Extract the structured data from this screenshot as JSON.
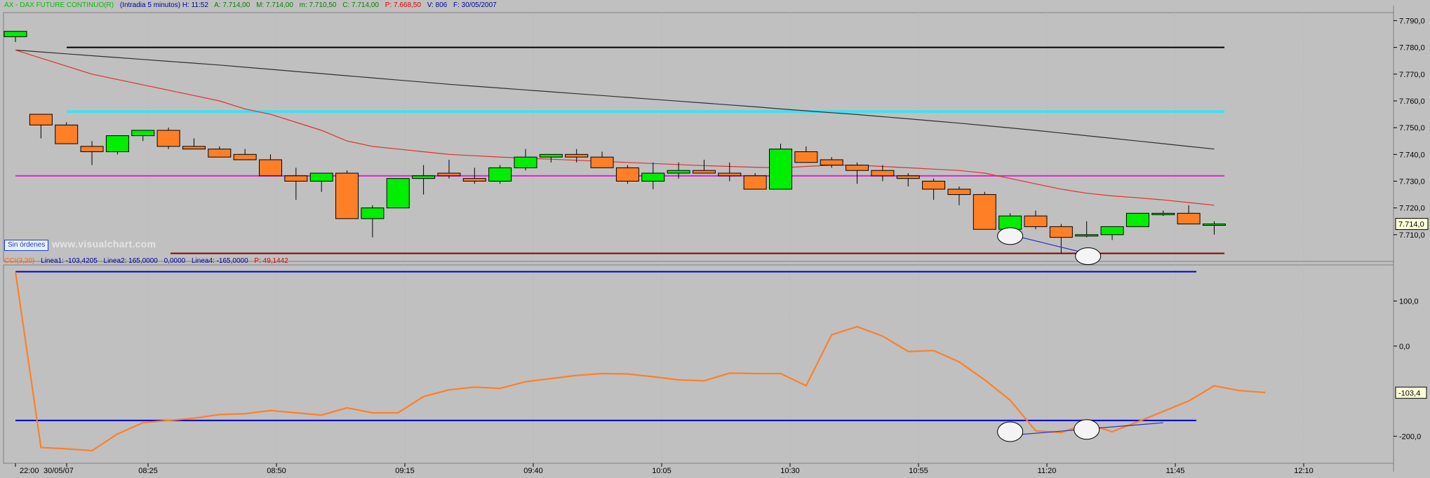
{
  "colors": {
    "up": "#00ee00",
    "down": "#ff7f27",
    "price_ma1": "#e03030",
    "price_ma2": "#303030",
    "line_cyan": "#40e0f0",
    "line_magenta": "#e020e0",
    "line_black": "#000000",
    "line_darkred": "#8b0000",
    "cci": "#ff7f27",
    "bound": "#0000cc"
  },
  "top_header": {
    "name": "AX - DAX FUTURE CONTINUO(R)",
    "period": "(Intradia 5 minutos) H: 11:52",
    "a": "A: 7.714,00",
    "m": "M: 7.714,00",
    "mn": "m: 7.710,50",
    "c": "C: 7.714,00",
    "p": "P: 7.668,50",
    "v": "V: 806",
    "f": "F: 30/05/2007"
  },
  "bottom_header": {
    "name": "CCI(3,20)",
    "l1": "Linea1: -103,4205",
    "l2": "Linea2: 165,0000",
    "l3": "0,0000",
    "l4": "Linea4: -165,0000",
    "p": "P: 49,1442"
  },
  "orders_badge": "Sin órdenes",
  "watermark": "www.visualchart.com",
  "last_price_label": "7.714,0",
  "last_cci_label": "-103,4",
  "chart_data": [
    {
      "type": "candlestick",
      "x_labels": [
        "22:00",
        "30/05/07",
        "08:25",
        "08:50",
        "09:15",
        "09:40",
        "10:05",
        "10:30",
        "10:55",
        "11:20",
        "11:45",
        "12:10"
      ],
      "y_ticks": [
        "7.790,0",
        "7.780,0",
        "7.770,0",
        "7.760,0",
        "7.750,0",
        "7.740,0",
        "7.730,0",
        "7.720,0",
        "7.710,0"
      ],
      "ylim": [
        7700,
        7793
      ],
      "candles": [
        {
          "o": 7784,
          "h": 7786,
          "l": 7782,
          "c": 7786
        },
        {
          "o": 7755,
          "h": 7755,
          "l": 7746,
          "c": 7751
        },
        {
          "o": 7751,
          "h": 7752,
          "l": 7744,
          "c": 7744
        },
        {
          "o": 7743,
          "h": 7745,
          "l": 7736,
          "c": 7741
        },
        {
          "o": 7741,
          "h": 7747,
          "l": 7740,
          "c": 7747
        },
        {
          "o": 7747,
          "h": 7749,
          "l": 7745,
          "c": 7749
        },
        {
          "o": 7749,
          "h": 7750,
          "l": 7742,
          "c": 7743
        },
        {
          "o": 7743,
          "h": 7746,
          "l": 7742,
          "c": 7742
        },
        {
          "o": 7742,
          "h": 7743,
          "l": 7739,
          "c": 7739
        },
        {
          "o": 7740,
          "h": 7742,
          "l": 7738,
          "c": 7738
        },
        {
          "o": 7738,
          "h": 7740,
          "l": 7732,
          "c": 7732
        },
        {
          "o": 7732,
          "h": 7735,
          "l": 7723,
          "c": 7730
        },
        {
          "o": 7730,
          "h": 7733,
          "l": 7726,
          "c": 7733
        },
        {
          "o": 7733,
          "h": 7734,
          "l": 7716,
          "c": 7716
        },
        {
          "o": 7716,
          "h": 7721,
          "l": 7709,
          "c": 7720
        },
        {
          "o": 7720,
          "h": 7731,
          "l": 7720,
          "c": 7731
        },
        {
          "o": 7731,
          "h": 7736,
          "l": 7725,
          "c": 7732
        },
        {
          "o": 7733,
          "h": 7738,
          "l": 7731,
          "c": 7732
        },
        {
          "o": 7731,
          "h": 7735,
          "l": 7729,
          "c": 7730
        },
        {
          "o": 7730,
          "h": 7736,
          "l": 7729,
          "c": 7735
        },
        {
          "o": 7735,
          "h": 7742,
          "l": 7734,
          "c": 7739
        },
        {
          "o": 7739,
          "h": 7740,
          "l": 7737,
          "c": 7740
        },
        {
          "o": 7740,
          "h": 7742,
          "l": 7737,
          "c": 7739
        },
        {
          "o": 7739,
          "h": 7741,
          "l": 7735,
          "c": 7735
        },
        {
          "o": 7735,
          "h": 7736,
          "l": 7729,
          "c": 7730
        },
        {
          "o": 7730,
          "h": 7737,
          "l": 7727,
          "c": 7733
        },
        {
          "o": 7733,
          "h": 7737,
          "l": 7731,
          "c": 7734
        },
        {
          "o": 7734,
          "h": 7738,
          "l": 7733,
          "c": 7733
        },
        {
          "o": 7733,
          "h": 7737,
          "l": 7730,
          "c": 7732
        },
        {
          "o": 7732,
          "h": 7733,
          "l": 7727,
          "c": 7727
        },
        {
          "o": 7727,
          "h": 7744,
          "l": 7727,
          "c": 7742
        },
        {
          "o": 7741,
          "h": 7743,
          "l": 7737,
          "c": 7737
        },
        {
          "o": 7738,
          "h": 7739,
          "l": 7735,
          "c": 7736
        },
        {
          "o": 7736,
          "h": 7737,
          "l": 7729,
          "c": 7734
        },
        {
          "o": 7734,
          "h": 7736,
          "l": 7730,
          "c": 7732
        },
        {
          "o": 7732,
          "h": 7733,
          "l": 7728,
          "c": 7731
        },
        {
          "o": 7730,
          "h": 7731,
          "l": 7723,
          "c": 7727
        },
        {
          "o": 7727,
          "h": 7728,
          "l": 7721,
          "c": 7725
        },
        {
          "o": 7725,
          "h": 7726,
          "l": 7712,
          "c": 7712
        },
        {
          "o": 7712,
          "h": 7718,
          "l": 7711,
          "c": 7717
        },
        {
          "o": 7717,
          "h": 7719,
          "l": 7712,
          "c": 7713
        },
        {
          "o": 7713,
          "h": 7714,
          "l": 7703,
          "c": 7709
        },
        {
          "o": 7710,
          "h": 7715,
          "l": 7709,
          "c": 7710
        },
        {
          "o": 7710,
          "h": 7711,
          "l": 7708,
          "c": 7713
        },
        {
          "o": 7713,
          "h": 7718,
          "l": 7713,
          "c": 7718
        },
        {
          "o": 7718,
          "h": 7719,
          "l": 7717,
          "c": 7718
        },
        {
          "o": 7718,
          "h": 7721,
          "l": 7714,
          "c": 7714
        },
        {
          "o": 7714,
          "h": 7715,
          "l": 7710,
          "c": 7714
        }
      ],
      "moving_average_red": [
        7779,
        7776,
        7773,
        7770,
        7768,
        7766,
        7764,
        7762,
        7760,
        7757,
        7755,
        7752,
        7749,
        7745,
        7743,
        7742,
        7741,
        7740,
        7739.5,
        7739,
        7738.6,
        7738.2,
        7737.8,
        7737.4,
        7737,
        7736.6,
        7736.2,
        7735.8,
        7735.5,
        7735.2,
        7735,
        7735.5,
        7736,
        7736,
        7735.5,
        7735,
        7734.5,
        7734,
        7733,
        7731,
        7729,
        7727,
        7725.5,
        7724.5,
        7723.8,
        7723,
        7722,
        7721
      ],
      "moving_average_black": [
        7779,
        7778.3,
        7777.6,
        7776.9,
        7776.2,
        7775.5,
        7774.8,
        7774.1,
        7773.4,
        7772.6,
        7771.8,
        7771,
        7770.2,
        7769.4,
        7768.6,
        7767.8,
        7767,
        7766.2,
        7765.5,
        7764.8,
        7764.1,
        7763.4,
        7762.7,
        7762,
        7761.3,
        7760.6,
        7759.9,
        7759.2,
        7758.5,
        7757.8,
        7757,
        7756.3,
        7755.6,
        7754.9,
        7754.1,
        7753.3,
        7752.5,
        7751.7,
        7750.8,
        7749.9,
        7749,
        7748,
        7747,
        7746,
        7745,
        7744,
        7743,
        7742
      ],
      "horizontal_lines": [
        7780,
        7756,
        7732,
        7703
      ],
      "trendline": {
        "x1": 39,
        "y1": 7710,
        "x2": 42,
        "y2": 7703
      }
    },
    {
      "type": "line",
      "name": "CCI(3,20)",
      "y_ticks": [
        "100,0",
        "0,0",
        "-200,0"
      ],
      "ylim": [
        -260,
        180
      ],
      "bounds": [
        165,
        -165
      ],
      "values": [
        165,
        -225,
        -228,
        -232,
        -195,
        -170,
        -165,
        -160,
        -152,
        -150,
        -143,
        -148,
        -153,
        -137,
        -148,
        -148,
        -112,
        -97,
        -91,
        -94,
        -79,
        -72,
        -65,
        -61,
        -62,
        -68,
        -75,
        -77,
        -60,
        -61,
        -61,
        -88,
        25,
        43,
        22,
        -12,
        -10,
        -35,
        -75,
        -120,
        -188,
        -192,
        -172,
        -190,
        -168,
        -145,
        -122,
        -88,
        -99,
        -103
      ],
      "trendline": {
        "x1": 39,
        "y1": -198,
        "x2": 45,
        "y2": -170
      }
    }
  ]
}
